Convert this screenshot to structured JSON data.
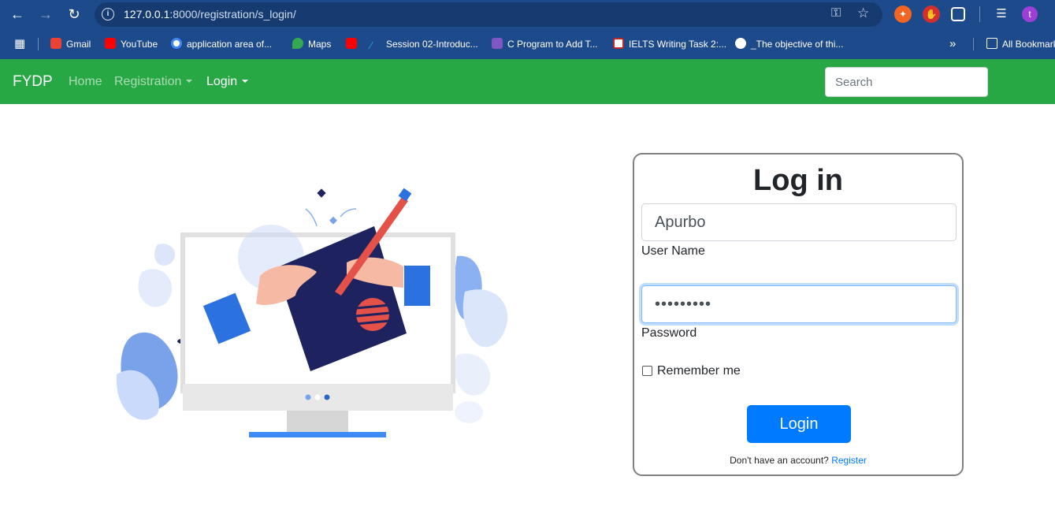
{
  "browser": {
    "url_host": "127.0.0.1",
    "url_path": ":8000/registration/s_login/",
    "profile_initial": "t",
    "bookmarks": [
      {
        "label": "Gmail",
        "icon": "gmail-icon",
        "color": "#ea4335"
      },
      {
        "label": "YouTube",
        "icon": "youtube-icon",
        "color": "#ff0000"
      },
      {
        "label": "application area of...",
        "icon": "google-icon",
        "color": "#4285f4"
      },
      {
        "label": "Maps",
        "icon": "maps-icon",
        "color": "#34a853"
      },
      {
        "label": "",
        "icon": "youtube-icon",
        "color": "#ff0000"
      },
      {
        "label": "Session 02-Introduc...",
        "icon": "session-icon",
        "color": "#2aa1f4"
      },
      {
        "label": "C Program to Add T...",
        "icon": "program-icon",
        "color": "#7e57c2"
      },
      {
        "label": "IELTS Writing Task 2:...",
        "icon": "liz-icon",
        "color": "#c62828"
      },
      {
        "label": "_The objective of thi...",
        "icon": "globe-icon",
        "color": "#ffffff"
      }
    ],
    "overflow": "»",
    "all_bookmarks": "All Bookmarks"
  },
  "navbar": {
    "brand": "FYDP",
    "links": [
      {
        "label": "Home",
        "dropdown": false
      },
      {
        "label": "Registration",
        "dropdown": true
      },
      {
        "label": "Login",
        "dropdown": true
      }
    ],
    "search_placeholder": "Search",
    "color": "#28a745"
  },
  "login": {
    "title": "Log in",
    "username_value": "Apurbo",
    "username_label": "User Name",
    "password_value": "•••••••••",
    "password_label": "Password",
    "remember_label": "Remember me",
    "remember_checked": false,
    "submit_label": "Login",
    "no_account_text": "Don't have an account?",
    "register_link": "Register",
    "button_color": "#007bff"
  }
}
